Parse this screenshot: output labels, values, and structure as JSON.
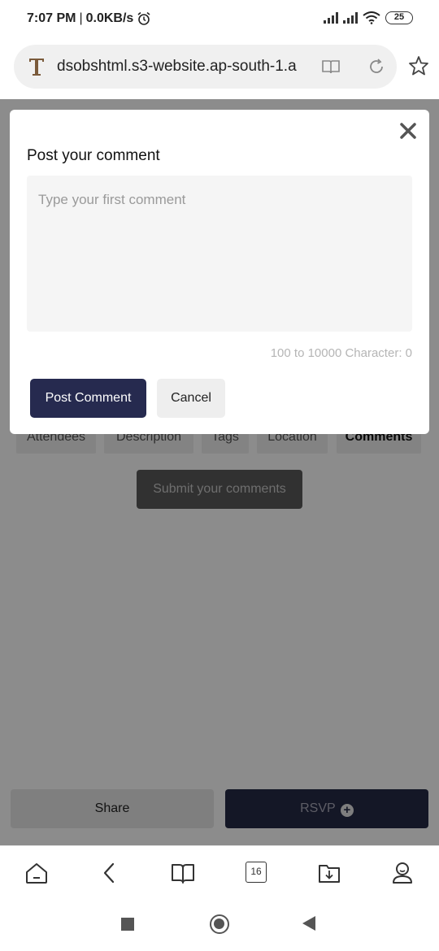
{
  "status_bar": {
    "time": "7:07 PM",
    "separator": "|",
    "speed": "0.0KB/s",
    "battery": "25"
  },
  "address_bar": {
    "url": "dsobshtml.s3-website.ap-south-1.a"
  },
  "tabs": [
    {
      "label": "Attendees"
    },
    {
      "label": "Description"
    },
    {
      "label": "Tags"
    },
    {
      "label": "Location"
    },
    {
      "label": "Comments",
      "active": true
    }
  ],
  "page": {
    "submit_label": "Submit your comments",
    "share_label": "Share",
    "rsvp_label": "RSVP"
  },
  "modal": {
    "title": "Post your comment",
    "placeholder": "Type your first comment",
    "char_hint": "100 to 10000 Character: 0",
    "post_label": "Post Comment",
    "cancel_label": "Cancel"
  },
  "toolbar": {
    "tabs_count": "16"
  },
  "colors": {
    "primary": "#262a4f",
    "overlay": "rgba(0,0,0,0.45)"
  }
}
